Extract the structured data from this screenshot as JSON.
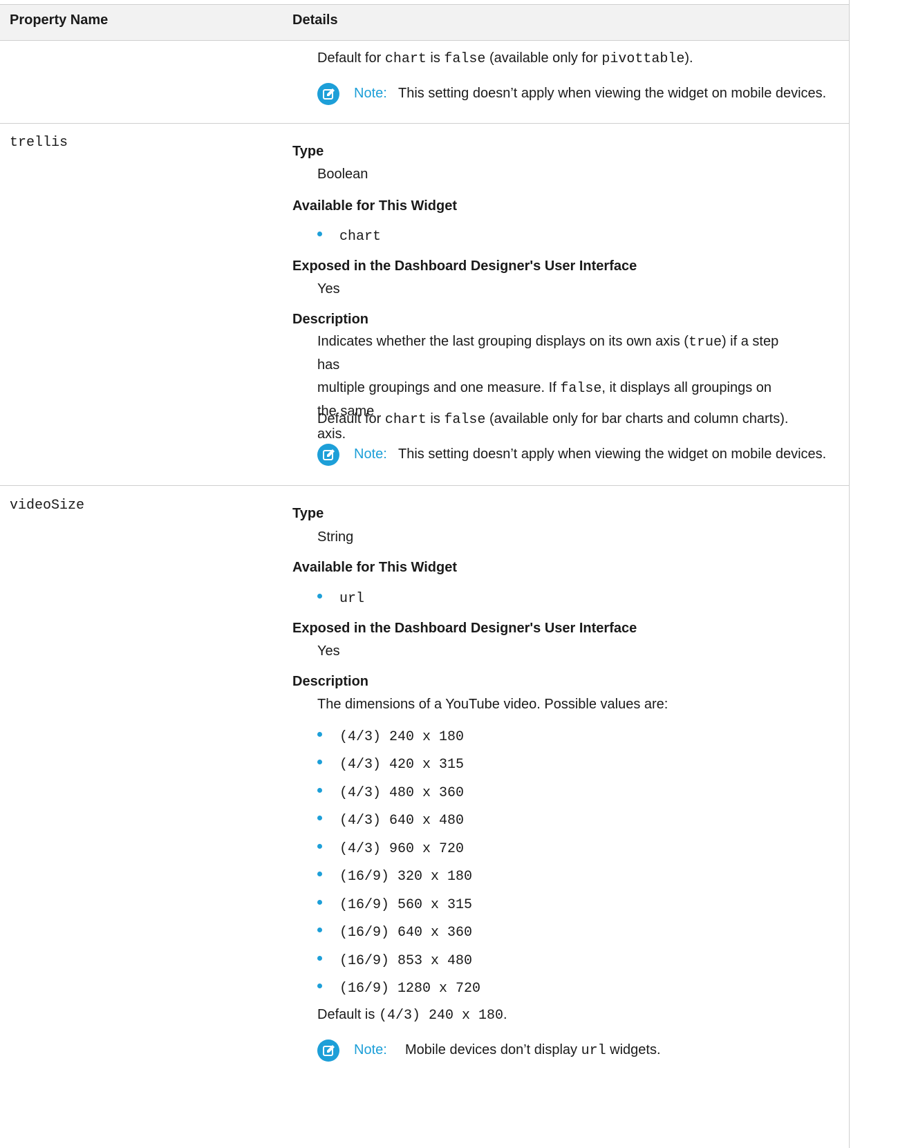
{
  "header": {
    "col1": "Property Name",
    "col2": "Details"
  },
  "top": {
    "default_prefix": "Default for",
    "default_code1": "chart",
    "default_mid": "is",
    "default_code2": "false",
    "default_suffix_pre": "(available only for",
    "default_code3": "pivottable",
    "default_suffix_post": ").",
    "note_label": "Note:",
    "note_text": "This setting doesn’t apply when viewing the widget on mobile devices."
  },
  "trellis": {
    "name": "trellis",
    "type_label": "Type",
    "type_value": "Boolean",
    "avail_label": "Available for This Widget",
    "avail_items": [
      "chart"
    ],
    "exposed_label": "Exposed in the Dashboard Designer's User Interface",
    "exposed_value": "Yes",
    "desc_label": "Description",
    "desc_1a": "Indicates whether the last grouping displays on its own axis (",
    "desc_1_code": "true",
    "desc_1b": ") if a step has",
    "desc_2a": "multiple groupings and one measure. If",
    "desc_2_code": "false",
    "desc_2b": ", it displays all groupings on the same",
    "desc_3": "axis.",
    "default_prefix": "Default for",
    "default_code1": "chart",
    "default_mid": "is",
    "default_code2": "false",
    "default_suffix": "(available only for bar charts and column charts).",
    "note_label": "Note:",
    "note_text": "This setting doesn’t apply when viewing the widget on mobile devices."
  },
  "videoSize": {
    "name": "videoSize",
    "type_label": "Type",
    "type_value": "String",
    "avail_label": "Available for This Widget",
    "avail_items": [
      "url"
    ],
    "exposed_label": "Exposed in the Dashboard Designer's User Interface",
    "exposed_value": "Yes",
    "desc_label": "Description",
    "desc_text": "The dimensions of a YouTube video. Possible values are:",
    "values": [
      "(4/3) 240 x 180",
      "(4/3) 420 x 315",
      "(4/3) 480 x 360",
      "(4/3) 640 x 480",
      "(4/3) 960 x 720",
      "(16/9) 320 x 180",
      "(16/9) 560 x 315",
      "(16/9) 640 x 360",
      "(16/9) 853 x 480",
      "(16/9) 1280 x 720"
    ],
    "default_prefix": "Default is",
    "default_code": "(4/3) 240 x 180",
    "default_suffix": ".",
    "note_label": "Note:",
    "note_pre": "Mobile devices don’t display",
    "note_code": "url",
    "note_post": "widgets."
  },
  "colors": {
    "accent": "#1d9fd8",
    "header_bg": "#f2f2f2",
    "rule": "#cfcfcf"
  }
}
